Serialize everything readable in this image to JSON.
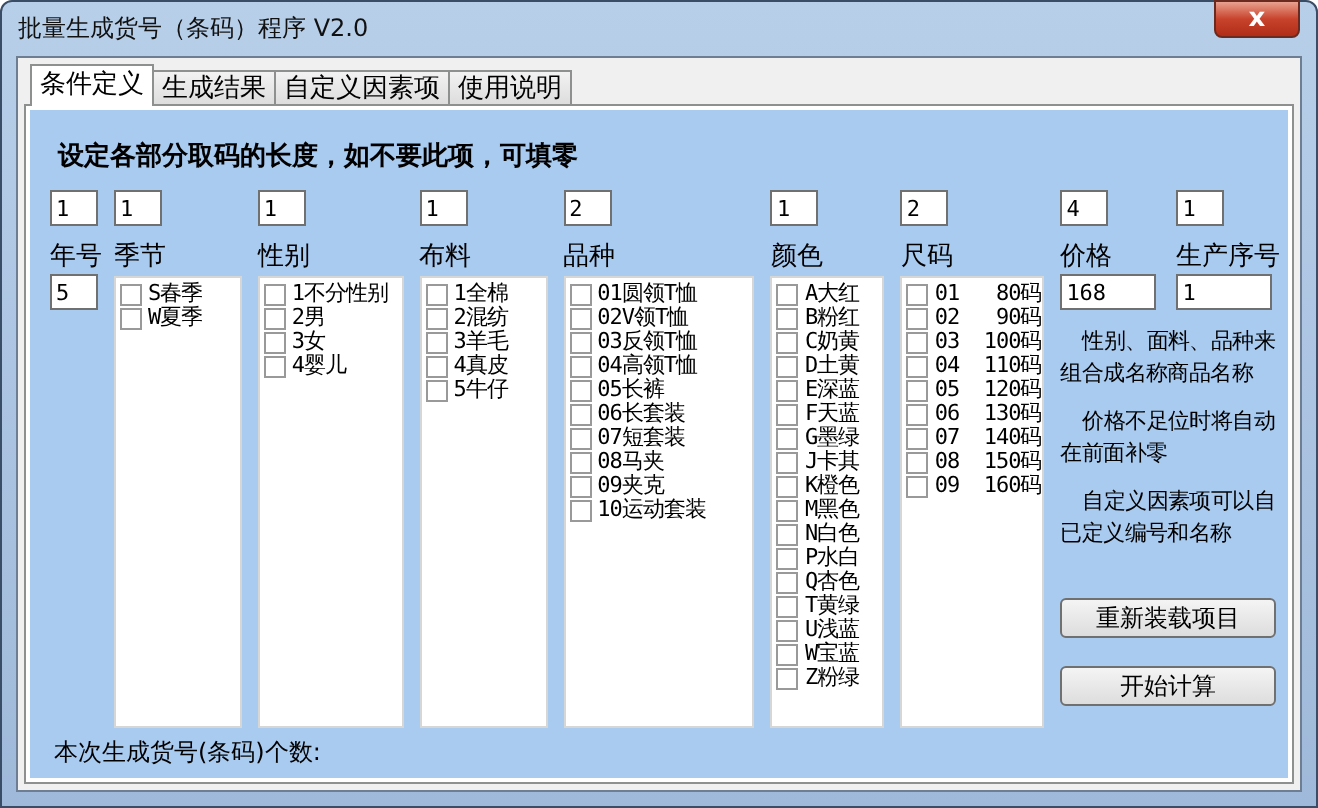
{
  "window": {
    "title": "批量生成货号（条码）程序 V2.0",
    "close": "x"
  },
  "tabs": [
    {
      "label": "条件定义",
      "selected": true
    },
    {
      "label": "生成结果",
      "selected": false
    },
    {
      "label": "自定义因素项",
      "selected": false
    },
    {
      "label": "使用说明",
      "selected": false
    }
  ],
  "heading": "设定各部分取码的长度，如不要此项，可填零",
  "fields": [
    {
      "label": "年号",
      "length": "1",
      "kind": "input",
      "value": "5"
    },
    {
      "label": "季节",
      "length": "1",
      "kind": "list",
      "items": [
        {
          "text": "S春季",
          "checked": false
        },
        {
          "text": "W夏季",
          "checked": false
        }
      ]
    },
    {
      "label": "性别",
      "length": "1",
      "kind": "list",
      "items": [
        {
          "text": "1不分性别",
          "checked": false
        },
        {
          "text": "2男",
          "checked": false
        },
        {
          "text": "3女",
          "checked": false
        },
        {
          "text": "4婴儿",
          "checked": false
        }
      ]
    },
    {
      "label": "布料",
      "length": "1",
      "kind": "list",
      "items": [
        {
          "text": "1全棉",
          "checked": false
        },
        {
          "text": "2混纺",
          "checked": false
        },
        {
          "text": "3羊毛",
          "checked": false
        },
        {
          "text": "4真皮",
          "checked": false
        },
        {
          "text": "5牛仔",
          "checked": false
        }
      ]
    },
    {
      "label": "品种",
      "length": "2",
      "kind": "list",
      "items": [
        {
          "text": "01圆领T恤",
          "checked": false
        },
        {
          "text": "02V领T恤",
          "checked": false
        },
        {
          "text": "03反领T恤",
          "checked": false
        },
        {
          "text": "04高领T恤",
          "checked": false
        },
        {
          "text": "05长裤",
          "checked": false
        },
        {
          "text": "06长套装",
          "checked": false
        },
        {
          "text": "07短套装",
          "checked": false
        },
        {
          "text": "08马夹",
          "checked": false
        },
        {
          "text": "09夹克",
          "checked": false
        },
        {
          "text": "10运动套装",
          "checked": false
        }
      ]
    },
    {
      "label": "颜色",
      "length": "1",
      "kind": "list",
      "items": [
        {
          "text": "A大红",
          "checked": false
        },
        {
          "text": "B粉红",
          "checked": false
        },
        {
          "text": "C奶黄",
          "checked": false
        },
        {
          "text": "D土黄",
          "checked": false
        },
        {
          "text": "E深蓝",
          "checked": false
        },
        {
          "text": "F天蓝",
          "checked": false
        },
        {
          "text": "G墨绿",
          "checked": false
        },
        {
          "text": "J卡其",
          "checked": false
        },
        {
          "text": "K橙色",
          "checked": false
        },
        {
          "text": "M黑色",
          "checked": false
        },
        {
          "text": "N白色",
          "checked": false
        },
        {
          "text": "P水白",
          "checked": false
        },
        {
          "text": "Q杏色",
          "checked": false
        },
        {
          "text": "T黄绿",
          "checked": false
        },
        {
          "text": "U浅蓝",
          "checked": false
        },
        {
          "text": "W宝蓝",
          "checked": false
        },
        {
          "text": "Z粉绿",
          "checked": false
        }
      ]
    },
    {
      "label": "尺码",
      "length": "2",
      "kind": "list",
      "items": [
        {
          "text": "01   80码",
          "checked": false
        },
        {
          "text": "02   90码",
          "checked": false
        },
        {
          "text": "03  100码",
          "checked": false
        },
        {
          "text": "04  110码",
          "checked": false
        },
        {
          "text": "05  120码",
          "checked": false
        },
        {
          "text": "06  130码",
          "checked": false
        },
        {
          "text": "07  140码",
          "checked": false
        },
        {
          "text": "08  150码",
          "checked": false
        },
        {
          "text": "09  160码",
          "checked": false
        }
      ]
    }
  ],
  "side_fields": [
    {
      "label": "价格",
      "length": "4",
      "value": "168"
    },
    {
      "label": "生产序号",
      "length": "1",
      "value": "1"
    }
  ],
  "notes": [
    "性别、面料、品种来组合成名称商品名称",
    "价格不足位时将自动在前面补零",
    "自定义因素项可以自已定义编号和名称"
  ],
  "buttons": [
    "重新装载项目",
    "开始计算"
  ],
  "status_label": "本次生成货号(条码)个数:"
}
